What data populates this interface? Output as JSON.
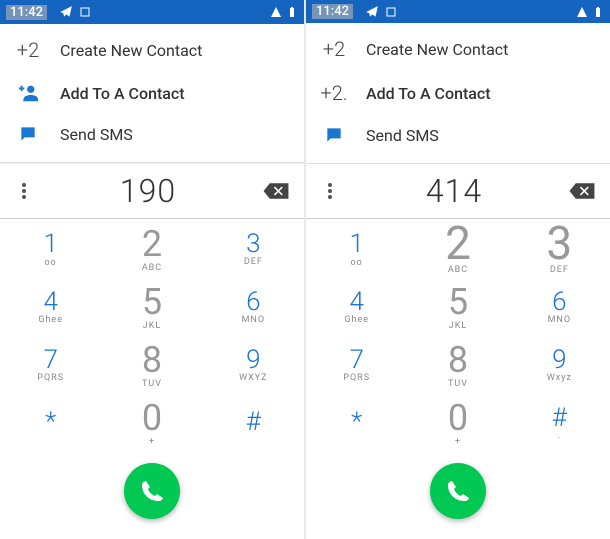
{
  "statusbar": {
    "time": "11:42"
  },
  "actions": {
    "create_prefix": "+2",
    "create_label": "Create New Contact",
    "add_prefix": "+2",
    "add_label": "Add To A Contact",
    "sms_label": "Send SMS"
  },
  "keys": {
    "k0": {
      "n": "0",
      "s": "+"
    },
    "k1": {
      "n": "1",
      "s": "ᴏᴏ"
    },
    "k2": {
      "n": "2",
      "s": "ABC"
    },
    "k3": {
      "n": "3",
      "s": "DEF"
    },
    "k4": {
      "n": "4",
      "s": "Ghee"
    },
    "k5": {
      "n": "5",
      "s": "JKL"
    },
    "k6": {
      "n": "6",
      "s": "MNO"
    },
    "k7": {
      "n": "7",
      "s": "PQRS"
    },
    "k8": {
      "n": "8",
      "s": "TUV"
    },
    "k9": {
      "n": "9",
      "s": "WXYZ"
    },
    "star": {
      "n": "*",
      "s": ""
    },
    "hash": {
      "n": "#",
      "s": ""
    }
  },
  "left": {
    "number": "190",
    "add_icon": "person-add"
  },
  "right": {
    "number": "414",
    "add_prefix_override": "+2.",
    "k2_style": "huge",
    "k3_style": "huge",
    "k9_sub": "Wxyz",
    "hash_sub": "."
  }
}
